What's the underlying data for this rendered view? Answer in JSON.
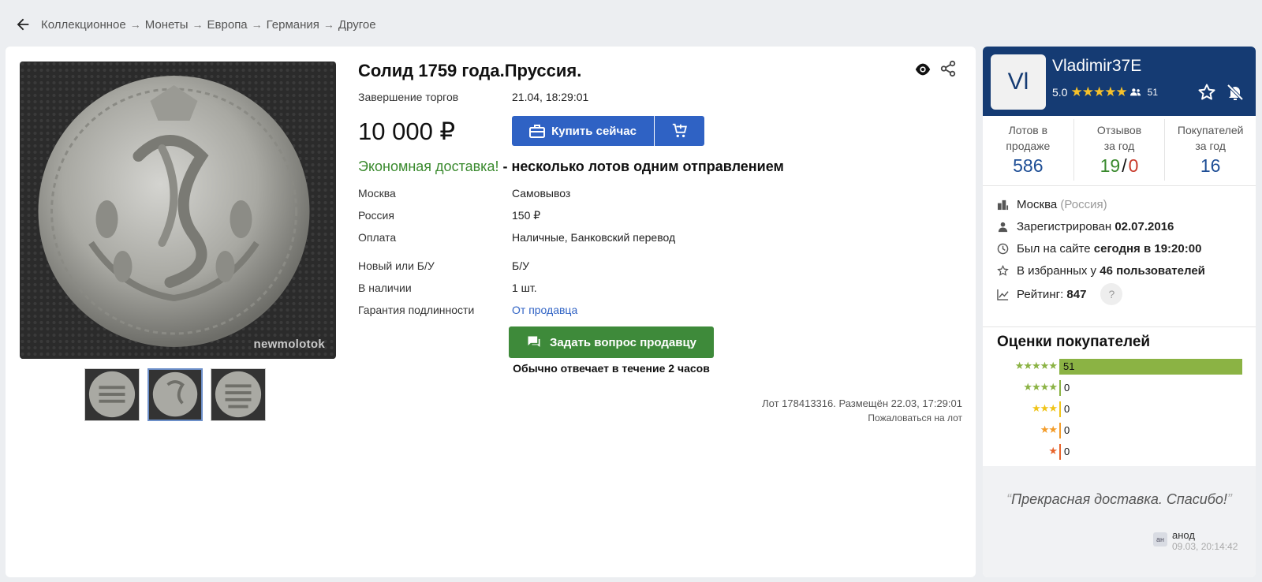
{
  "breadcrumb": {
    "items": [
      "Коллекционное",
      "Монеты",
      "Европа",
      "Германия",
      "Другое"
    ],
    "separator": "→"
  },
  "lot": {
    "title": "Солид 1759 года.Пруссия.",
    "end_label": "Завершение торгов",
    "end_value": "21.04, 18:29:01",
    "price": "10 000 ₽",
    "buy_label": "Купить сейчас",
    "econ_green": "Экономная доставка!",
    "econ_rest": " - несколько лотов одним отправлением",
    "details": [
      {
        "label": "Москва",
        "value": "Самовывоз"
      },
      {
        "label": "Россия",
        "value": "150 ₽"
      },
      {
        "label": "Оплата",
        "value": "Наличные, Банковский перевод"
      },
      {
        "label": "Новый или Б/У",
        "value": "Б/У"
      },
      {
        "label": "В наличии",
        "value": "1 шт."
      },
      {
        "label": "Гарантия подлинности",
        "value": "От продавца"
      }
    ],
    "ask_label": "Задать вопрос продавцу",
    "reply_note": "Обычно отвечает в течение 2 часов",
    "lot_info": "Лот 178413316. Размещён 22.03, 17:29:01",
    "report_label": "Пожаловаться на лот",
    "watermark": "newmolotok"
  },
  "seller": {
    "initials": "Vl",
    "name": "Vladimir37E",
    "rating": "5.0",
    "stars": "★★★★★",
    "users_count": "51",
    "stats": [
      {
        "title": "Лотов в продаже",
        "value": "586"
      },
      {
        "title": "Отзывов за год",
        "good": "19",
        "sep": "/",
        "bad": "0"
      },
      {
        "title": "Покупателей за год",
        "value": "16"
      }
    ],
    "city": "Москва",
    "country": "(Россия)",
    "registered_label": "Зарегистрирован",
    "registered_date": "02.07.2016",
    "seen_label": "Был на сайте",
    "seen_value": "сегодня в 19:20:00",
    "fav_label": "В избранных у",
    "fav_value": "46 пользователей",
    "rating_label": "Рейтинг:",
    "rating_value": "847",
    "help": "?"
  },
  "ratings": {
    "title": "Оценки покупателей",
    "rows": [
      {
        "stars": "★★★★★",
        "count": "51",
        "fraction": 1.0,
        "color": "#8bb344"
      },
      {
        "stars": "★★★★",
        "count": "0",
        "fraction": 0,
        "color": "#8bb344"
      },
      {
        "stars": "★★★",
        "count": "0",
        "fraction": 0,
        "color": "#f0c419"
      },
      {
        "stars": "★★",
        "count": "0",
        "fraction": 0,
        "color": "#f39c2a"
      },
      {
        "stars": "★",
        "count": "0",
        "fraction": 0,
        "color": "#e8642b"
      }
    ]
  },
  "review": {
    "open_quote": "“",
    "text": "Прекрасная доставка. Спасибо!",
    "close_quote": "”",
    "avatar": "ан",
    "author": "анод",
    "date": "09.03, 20:14:42"
  },
  "colors": {
    "accent_blue": "#2f62c4",
    "green_button": "#3e8a3a",
    "seller_header": "#153b73"
  }
}
